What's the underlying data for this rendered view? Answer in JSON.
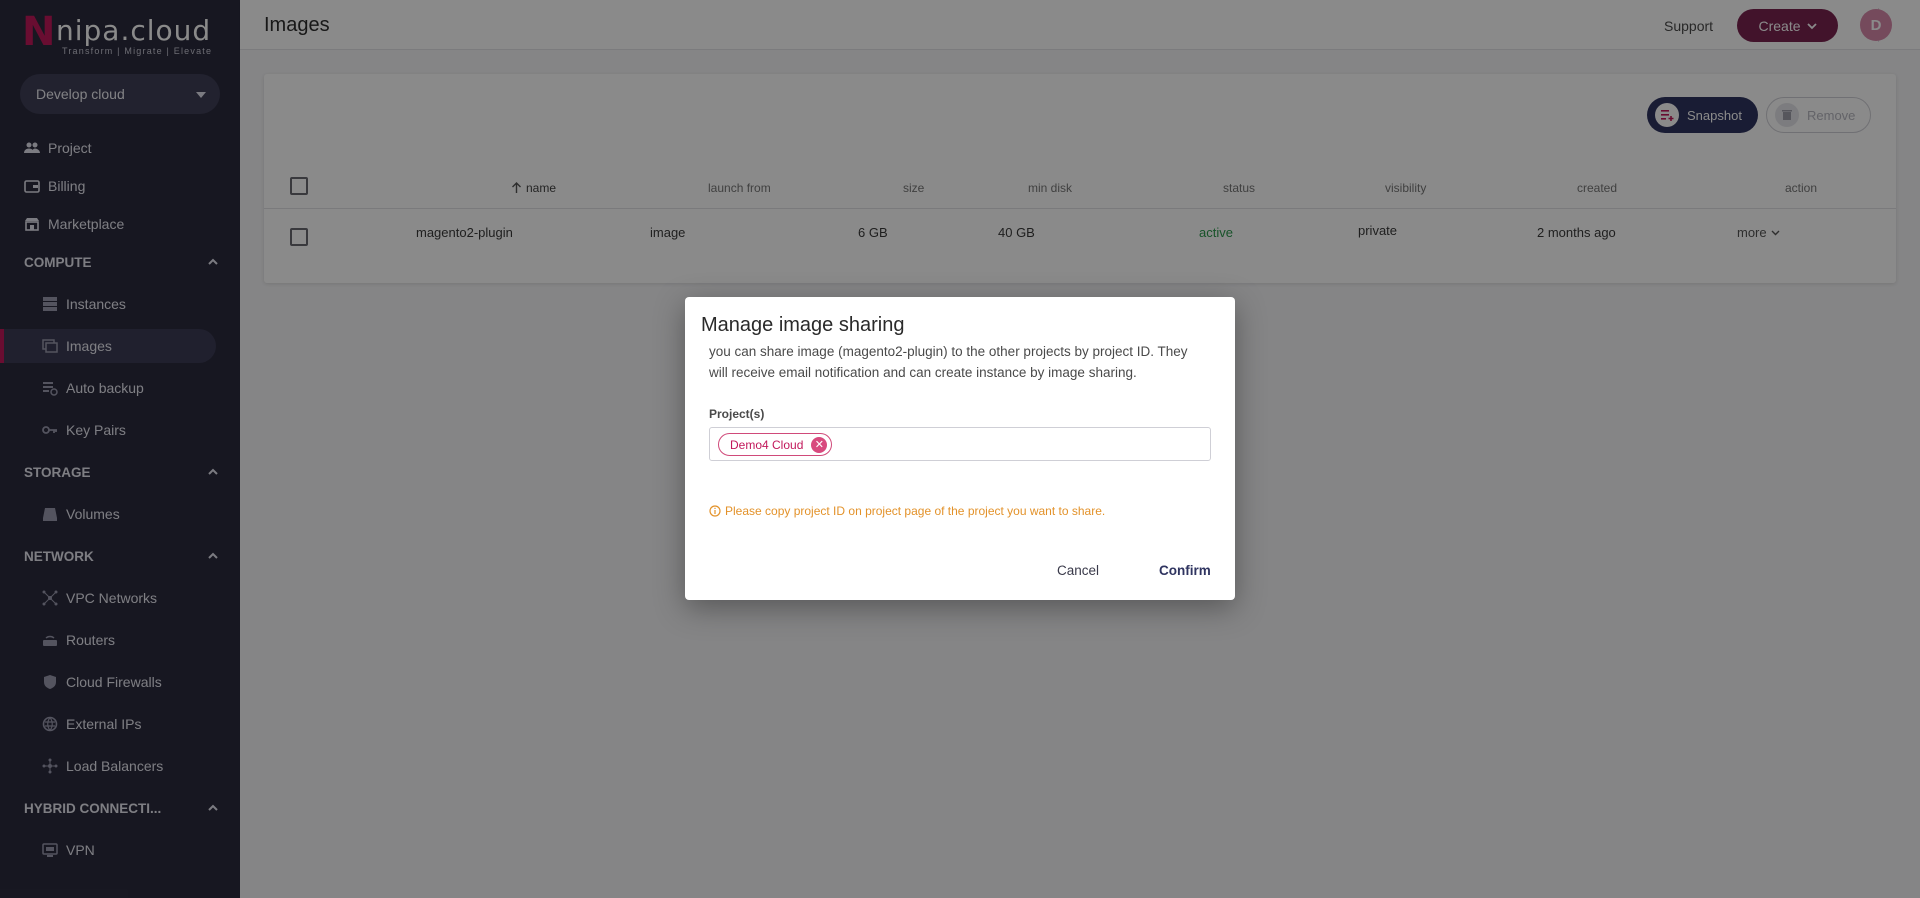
{
  "app": {
    "logo_text": "nipa.cloud",
    "logo_tagline": "Transform  |  Migrate  |  Elevate",
    "project_selector": "Develop cloud"
  },
  "header": {
    "title": "Images",
    "support": "Support",
    "create": "Create",
    "avatar_initial": "D"
  },
  "sidebar": {
    "top_items": [
      {
        "label": "Project",
        "icon": "people-icon"
      },
      {
        "label": "Billing",
        "icon": "billing-icon"
      },
      {
        "label": "Marketplace",
        "icon": "store-icon"
      }
    ],
    "sections": [
      {
        "title": "COMPUTE",
        "items": [
          {
            "label": "Instances",
            "icon": "server-icon"
          },
          {
            "label": "Images",
            "icon": "image-copy-icon",
            "active": true
          },
          {
            "label": "Auto backup",
            "icon": "backup-icon"
          },
          {
            "label": "Key Pairs",
            "icon": "key-icon"
          }
        ]
      },
      {
        "title": "STORAGE",
        "items": [
          {
            "label": "Volumes",
            "icon": "volume-icon"
          }
        ]
      },
      {
        "title": "NETWORK",
        "items": [
          {
            "label": "VPC Networks",
            "icon": "vpc-icon"
          },
          {
            "label": "Routers",
            "icon": "router-icon"
          },
          {
            "label": "Cloud Firewalls",
            "icon": "shield-icon"
          },
          {
            "label": "External IPs",
            "icon": "globe-icon"
          },
          {
            "label": "Load Balancers",
            "icon": "load-balancer-icon"
          }
        ]
      },
      {
        "title": "HYBRID CONNECTI...",
        "items": [
          {
            "label": "VPN",
            "icon": "vpn-icon"
          }
        ]
      }
    ]
  },
  "toolbar": {
    "snapshot": "Snapshot",
    "remove": "Remove"
  },
  "table": {
    "columns": [
      "name",
      "launch from",
      "size",
      "min disk",
      "status",
      "visibility",
      "created",
      "action"
    ],
    "rows": [
      {
        "name": "magento2-plugin",
        "launch_from": "image",
        "size": "6 GB",
        "min_disk": "40 GB",
        "status": "active",
        "visibility": "private",
        "created": "2 months ago",
        "action": "more"
      }
    ]
  },
  "dialog": {
    "title": "Manage image sharing",
    "description": "you can share image (magento2-plugin) to the other projects by project ID. They will receive email notification and can create instance by image sharing.",
    "field_label": "Project(s)",
    "chips": [
      "Demo4 Cloud"
    ],
    "hint": "Please copy project ID on project page of the project you want to share.",
    "cancel": "Cancel",
    "confirm": "Confirm"
  },
  "colors": {
    "sidebar_bg": "#2c2c3e",
    "brand_pink": "#c2185b",
    "create_button": "#7a2350",
    "snapshot_button": "#2f3460",
    "status_active": "#2e9a4e",
    "hint_orange": "#e3922a"
  }
}
